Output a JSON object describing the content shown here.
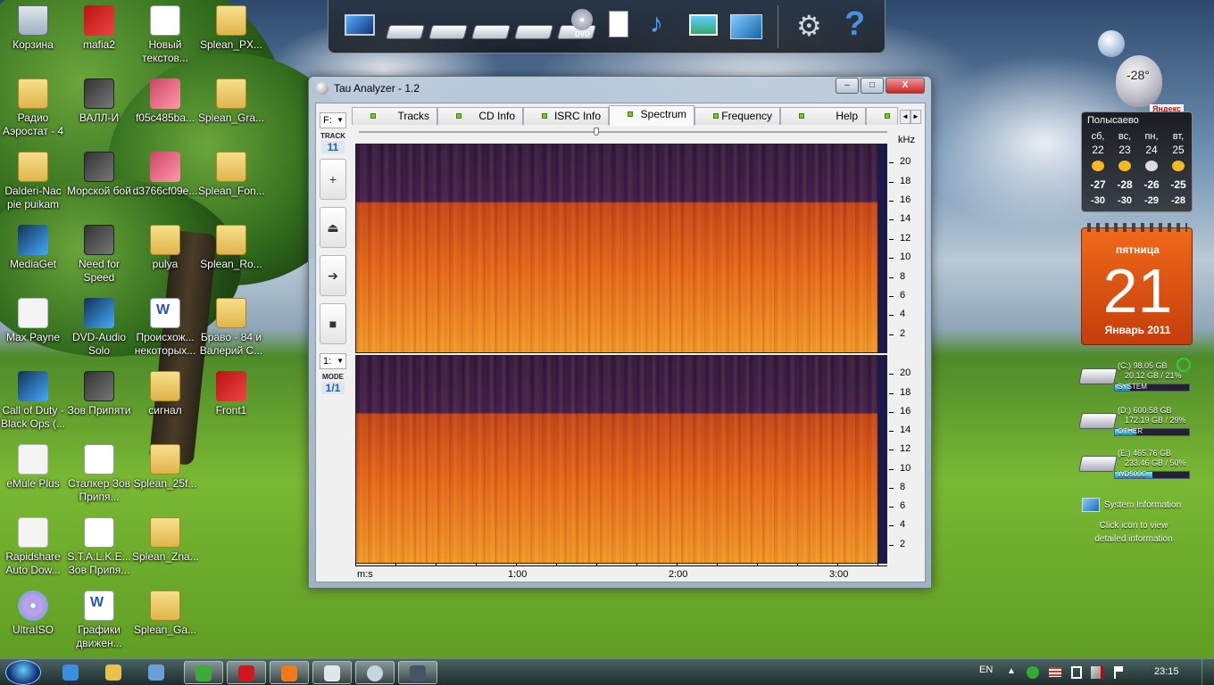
{
  "desktop_icons": [
    {
      "label": "Корзина",
      "kind": "recycle"
    },
    {
      "label": "mafia2",
      "kind": "red"
    },
    {
      "label": "Новый текстов...",
      "kind": "file"
    },
    {
      "label": "Splean_PX...",
      "kind": "folder"
    },
    {
      "label": "Радио Аэростат - 4",
      "kind": "folder"
    },
    {
      "label": "ВАЛЛ-И",
      "kind": "exe"
    },
    {
      "label": "f05c485ba...",
      "kind": "pink"
    },
    {
      "label": "Splean_Gra...",
      "kind": "folder"
    },
    {
      "label": "Dalderi-Nac pie puikam",
      "kind": "folder"
    },
    {
      "label": "Морской бой",
      "kind": "exe"
    },
    {
      "label": "d3766cf09e...",
      "kind": "pink"
    },
    {
      "label": "Splean_Fon...",
      "kind": "folder"
    },
    {
      "label": "MediaGet",
      "kind": "blue"
    },
    {
      "label": "Need for Speed",
      "kind": "exe"
    },
    {
      "label": "pulya",
      "kind": "folder"
    },
    {
      "label": "Splean_Ro...",
      "kind": "folder"
    },
    {
      "label": "Max Payne",
      "kind": "white"
    },
    {
      "label": "DVD-Audio Solo",
      "kind": "blue"
    },
    {
      "label": "Происхож... некоторых...",
      "kind": "word"
    },
    {
      "label": "Браво - 84 и Валерий С...",
      "kind": "folder"
    },
    {
      "label": "Call of Duty - Black Ops (...",
      "kind": "blue"
    },
    {
      "label": "Зов Припяти",
      "kind": "exe"
    },
    {
      "label": "сигнал",
      "kind": "folder"
    },
    {
      "label": "Front1",
      "kind": "red"
    },
    {
      "label": "eMule Plus",
      "kind": "white"
    },
    {
      "label": "Сталкер Зов Припя...",
      "kind": "file"
    },
    {
      "label": "Splean_25f...",
      "kind": "folder"
    },
    {
      "label": "Rapidshare Auto Dow...",
      "kind": "white"
    },
    {
      "label": "S.T.A.L.K.E... Зов Припя...",
      "kind": "file"
    },
    {
      "label": "Splean_Zna...",
      "kind": "folder"
    },
    {
      "label": "UltraISO",
      "kind": "cd"
    },
    {
      "label": "Графики движен...",
      "kind": "word"
    },
    {
      "label": "Splean_Ga...",
      "kind": "folder"
    }
  ],
  "dock": {
    "items": [
      "computer-icon",
      "drive-icon",
      "drive-icon",
      "drive-icon",
      "drive-icon",
      "dvd-drive-icon",
      "document-icon",
      "music-icon",
      "pictures-icon",
      "control-panel-icon"
    ],
    "settings_icon": "gear-icon",
    "help_icon": "help-icon",
    "dvd_label": "DVD"
  },
  "window": {
    "title": "Tau Analyzer - 1.2",
    "minimize": "–",
    "maximize": "□",
    "close": "X"
  },
  "toolbar": {
    "drive_select": "F:",
    "track_caption": "TRACK",
    "track_number": "11",
    "buttons": [
      {
        "name": "plus-button",
        "glyph": "+"
      },
      {
        "name": "eject-button",
        "glyph": "⏏"
      },
      {
        "name": "play-button",
        "glyph": "➔"
      },
      {
        "name": "stop-button",
        "glyph": "■"
      }
    ],
    "mode_select": "1:",
    "mode_caption": "MODE",
    "mode_value": "1/1"
  },
  "tabs": [
    {
      "label": "Tracks",
      "active": false
    },
    {
      "label": "CD Info",
      "active": false
    },
    {
      "label": "ISRC Info",
      "active": false
    },
    {
      "label": "Spectrum",
      "active": true
    },
    {
      "label": "Frequency",
      "active": false
    },
    {
      "label": "Help",
      "active": false
    }
  ],
  "tab_scroll": {
    "left": "◄",
    "right": "►"
  },
  "spectrum": {
    "freq_unit": "kHz",
    "freq_ticks": [
      "20",
      "18",
      "16",
      "14",
      "12",
      "10",
      "8",
      "6",
      "4",
      "2"
    ],
    "time_unit": "m:s",
    "time_ticks": [
      "1:00",
      "2:00",
      "3:00"
    ],
    "channels": 2,
    "cutoff_khz": 16,
    "max_khz": 22,
    "colors": {
      "background": "#2a1642",
      "signal_low": "#c4441a",
      "signal_high": "#f39a2a"
    }
  },
  "weather": {
    "temp_now": "-28°",
    "brand": "Яндекс",
    "city": "Полысаево",
    "days": [
      {
        "dow": "сб,",
        "date": "22",
        "hi": "-27",
        "lo": "-30"
      },
      {
        "dow": "вс,",
        "date": "23",
        "hi": "-28",
        "lo": "-30"
      },
      {
        "dow": "пн,",
        "date": "24",
        "hi": "-26",
        "lo": "-29"
      },
      {
        "dow": "вт,",
        "date": "25",
        "hi": "-25",
        "lo": "-28"
      }
    ]
  },
  "calendar": {
    "weekday": "пятница",
    "day": "21",
    "month_year": "Январь 2011"
  },
  "drives": [
    {
      "line1": "(C:) 98.05 GB",
      "line2": "20.12 GB / 21%",
      "name": "SYSTEM",
      "used": 0.21
    },
    {
      "line1": "(D:) 600.58 GB",
      "line2": "172.19 GB / 29%",
      "name": "OTHER",
      "used": 0.29
    },
    {
      "line1": "(E:) 465.76 GB",
      "line2": "233.46 GB / 50%",
      "name": "WD500G",
      "used": 0.5
    }
  ],
  "sysinfo": {
    "title": "System Information",
    "hint": "Click icon to view detailed information"
  },
  "taskbar": {
    "apps": [
      "ie-icon",
      "explorer-icon",
      "network-icon",
      "utorrent-icon",
      "opera-icon",
      "winamp-icon",
      "grid-icon",
      "tau-analyzer-icon",
      "camera-icon"
    ],
    "lang": "EN",
    "time": "23:15"
  }
}
